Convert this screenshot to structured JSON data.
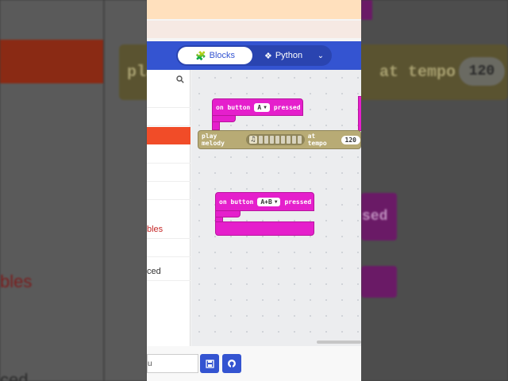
{
  "background": {
    "left_text_1": "bles",
    "left_text_2": "ced",
    "right_text_1": "at tempo",
    "right_play": "pla",
    "right_pill": "120",
    "right_mag_text": "sed"
  },
  "header": {
    "toggle": {
      "blocks_label": "Blocks",
      "python_label": "Python",
      "blocks_icon": "puzzle-icon",
      "python_icon": "python-icon",
      "dropdown_icon": "chevron-down-icon"
    }
  },
  "toolbox": {
    "search_icon": "search-icon",
    "items": [
      "",
      "",
      "",
      "",
      "",
      "",
      "bles",
      "",
      "ced"
    ]
  },
  "workspace": {
    "block1": {
      "prefix": "on button",
      "button": "A",
      "suffix": "pressed"
    },
    "melody": {
      "prefix": "play melody",
      "tempo_label": "at tempo",
      "tempo_value": "120"
    },
    "block2": {
      "prefix": "on button",
      "button": "A+B",
      "suffix": "pressed"
    }
  },
  "footer": {
    "name_value": "u",
    "save_icon": "save-icon",
    "github_icon": "github-icon"
  },
  "colors": {
    "accent": "#3454d1",
    "event_block": "#e51fcc",
    "music_block": "#b8ab75",
    "toolbox_active": "#f14c28"
  }
}
